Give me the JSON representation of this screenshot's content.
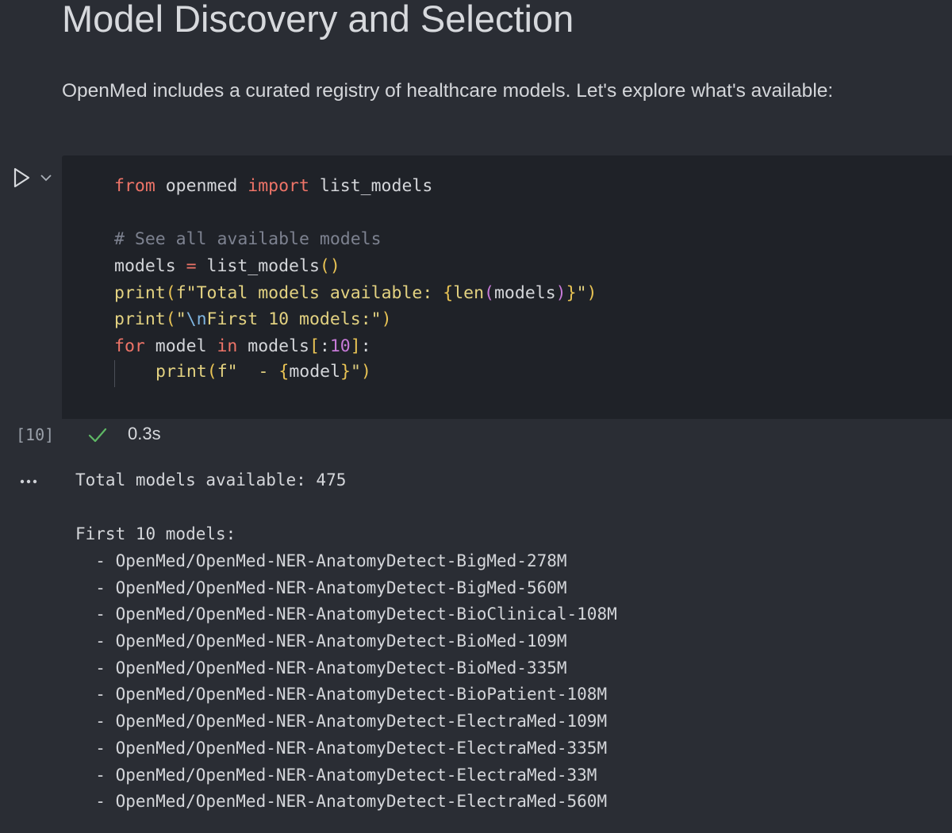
{
  "markdown": {
    "title": "Model Discovery and Selection",
    "body": "OpenMed includes a curated registry of healthcare models. Let's explore what's available:"
  },
  "code_cell": {
    "execution_count": "[10]",
    "status_icon": "check-icon",
    "execution_time": "0.3s",
    "run_icon": "play-icon",
    "expand_icon": "chevron-down-icon",
    "code": {
      "l1_kw_from": "from",
      "l1_module": " openmed ",
      "l1_kw_import": "import",
      "l1_name": " list_models",
      "l3_comment": "# See all available models",
      "l4_var": "models ",
      "l4_eq": "=",
      "l4_call": " list_models",
      "l4_paren": "()",
      "l5_print": "print",
      "l5_open": "(",
      "l5_str1": "f\"Total models available: ",
      "l5_brace_open": "{",
      "l5_len": "len",
      "l5_len_open": "(",
      "l5_arg": "models",
      "l5_len_close": ")",
      "l5_brace_close": "}",
      "l5_str2": "\"",
      "l5_close": ")",
      "l6_print": "print",
      "l6_open": "(",
      "l6_q": "\"",
      "l6_esc": "\\n",
      "l6_str": "First 10 models:\"",
      "l6_close": ")",
      "l7_kw_for": "for",
      "l7_var": " model ",
      "l7_kw_in": "in",
      "l7_models": " models",
      "l7_lb": "[",
      "l7_colon": ":",
      "l7_num": "10",
      "l7_rb": "]",
      "l7_end": ":",
      "l8_print": "print",
      "l8_open": "(",
      "l8_str1": "f\"  - ",
      "l8_brace_open": "{",
      "l8_var": "model",
      "l8_brace_close": "}",
      "l8_str2": "\"",
      "l8_close": ")"
    }
  },
  "output": {
    "more_icon": "ellipsis-icon",
    "total_line": "Total models available: 475",
    "heading_line": "First 10 models:",
    "models": [
      "  - OpenMed/OpenMed-NER-AnatomyDetect-BigMed-278M",
      "  - OpenMed/OpenMed-NER-AnatomyDetect-BigMed-560M",
      "  - OpenMed/OpenMed-NER-AnatomyDetect-BioClinical-108M",
      "  - OpenMed/OpenMed-NER-AnatomyDetect-BioMed-109M",
      "  - OpenMed/OpenMed-NER-AnatomyDetect-BioMed-335M",
      "  - OpenMed/OpenMed-NER-AnatomyDetect-BioPatient-108M",
      "  - OpenMed/OpenMed-NER-AnatomyDetect-ElectraMed-109M",
      "  - OpenMed/OpenMed-NER-AnatomyDetect-ElectraMed-335M",
      "  - OpenMed/OpenMed-NER-AnatomyDetect-ElectraMed-33M",
      "  - OpenMed/OpenMed-NER-AnatomyDetect-ElectraMed-560M"
    ]
  },
  "colors": {
    "background": "#2a2d34",
    "editor_background": "#1f2228",
    "keyword": "#ee7468",
    "function": "#e3d281",
    "comment": "#7d8290",
    "success": "#5fb865"
  }
}
